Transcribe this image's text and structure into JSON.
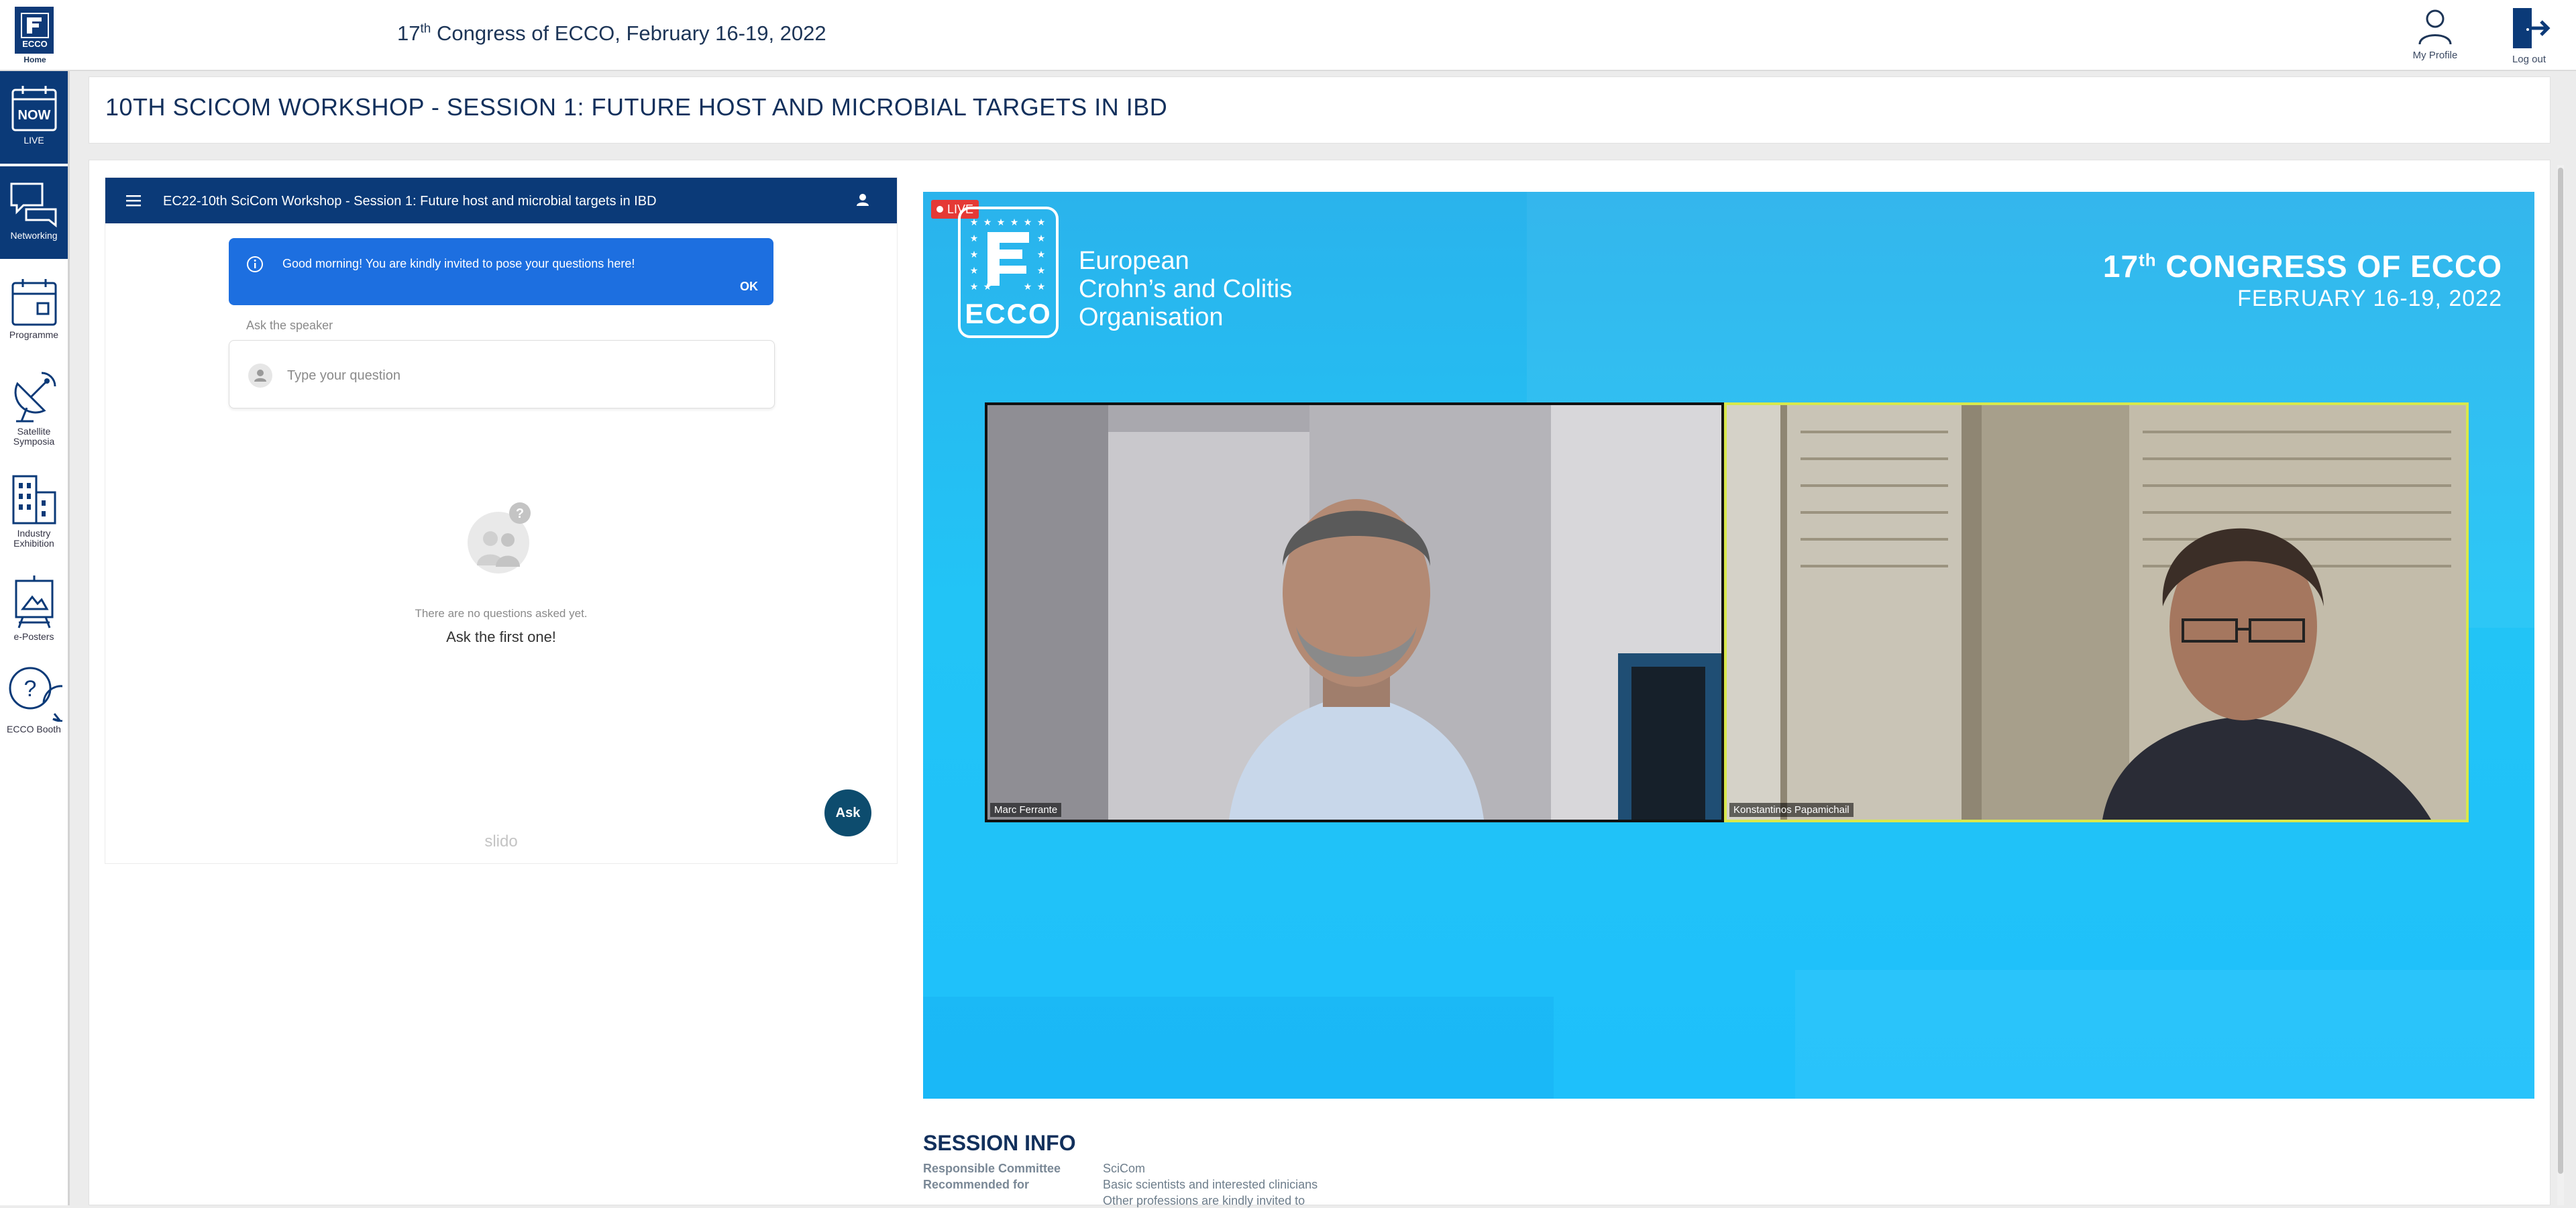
{
  "header": {
    "home_label": "Home",
    "title_prefix": "17",
    "title_sup": "th",
    "title_suffix": " Congress of ECCO, February 16-19, 2022",
    "profile_label": "My Profile",
    "logout_label": "Log out"
  },
  "nav": [
    {
      "label": "LIVE",
      "icon": "now-calendar-icon",
      "active": true
    },
    {
      "label": "Networking",
      "icon": "chat-bubbles-icon",
      "active": true
    },
    {
      "label": "Programme",
      "icon": "calendar-icon",
      "active": false
    },
    {
      "label": "Satellite Symposia",
      "icon": "satellite-dish-icon",
      "active": false
    },
    {
      "label": "Industry Exhibition",
      "icon": "buildings-icon",
      "active": false
    },
    {
      "label": "e-Posters",
      "icon": "poster-icon",
      "active": false
    },
    {
      "label": "ECCO Booth",
      "icon": "question-bubble-icon",
      "active": false
    }
  ],
  "session": {
    "title": "10TH SCICOM WORKSHOP - SESSION 1: FUTURE HOST AND MICROBIAL TARGETS IN IBD"
  },
  "slido": {
    "header_title": "EC22-10th SciCom Workshop - Session 1: Future host and microbial targets in IBD",
    "banner_text": "Good morning! You are kindly invited to pose your questions here!",
    "banner_ok": "OK",
    "ask_label": "Ask the speaker",
    "question_placeholder": "Type your question",
    "empty_line1": "There are no questions asked yet.",
    "empty_line2": "Ask the first one!",
    "ask_button": "Ask",
    "brand": "slido"
  },
  "video": {
    "live_badge": "LIVE",
    "logo_word": "ECCO",
    "org_line1": "European",
    "org_line2": "Crohn’s and Colitis",
    "org_line3": "Organisation",
    "congress_num": "17",
    "congress_sup": "th",
    "congress_rest": " CONGRESS OF ECCO",
    "congress_dates": "FEBRUARY 16-19, 2022",
    "speaker_left": "Marc Ferrante",
    "speaker_right": "Konstantinos Papamichail"
  },
  "session_info": {
    "heading": "SESSION INFO",
    "rows": [
      {
        "key": "Responsible Committee",
        "value": "SciCom"
      },
      {
        "key": "Recommended for",
        "value": "Basic scientists and interested clinicians"
      },
      {
        "key": "",
        "value": "Other professions are kindly invited to"
      }
    ]
  },
  "colors": {
    "brand_navy": "#0b3a78",
    "banner_blue": "#1d6fe0",
    "video_cyan": "#22c4f6",
    "live_red": "#e53935"
  }
}
